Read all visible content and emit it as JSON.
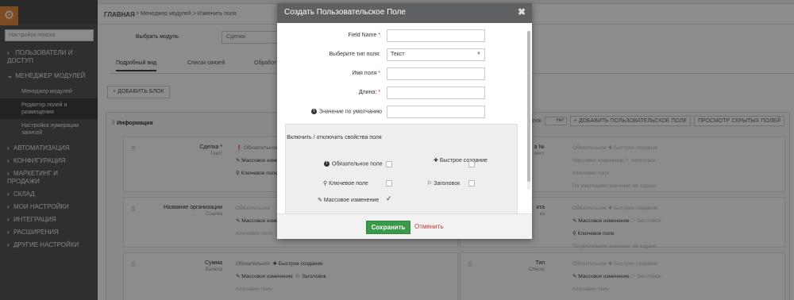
{
  "breadcrumb": {
    "home": "ГЛАВНАЯ",
    "rest": "> Менеджер модулей > Изменить поля"
  },
  "sidebar": {
    "search_placeholder": "Настройки поиска",
    "items": [
      {
        "label": "ПОЛЬЗОВАТЕЛИ И ДОСТУП",
        "chev": "›"
      },
      {
        "label": "МЕНЕДЖЕР МОДУЛЕЙ",
        "chev": "⌄"
      }
    ],
    "subitems": [
      {
        "label": "Менеджер модулей"
      },
      {
        "label": "Редактор полей и размещения"
      },
      {
        "label": "Настройка нумерации записей"
      }
    ],
    "items_after": [
      {
        "label": "АВТОМАТИЗАЦИЯ"
      },
      {
        "label": "КОНФИГУРАЦИЯ"
      },
      {
        "label": "МАРКЕТИНГ И ПРОДАЖИ"
      },
      {
        "label": "СКЛАД"
      },
      {
        "label": "МОИ НАСТРОЙКИ"
      },
      {
        "label": "ИНТЕГРАЦИЯ"
      },
      {
        "label": "РАСШИРЕНИЯ"
      },
      {
        "label": "ДРУГИЕ НАСТРОЙКИ"
      }
    ]
  },
  "main": {
    "select_label": "Выбрать модуль",
    "select_value": "Сделки",
    "tabs": [
      "Подробный вид",
      "Список связей",
      "Обработ"
    ],
    "add_block": "ДОБАВИТЬ БЛОК",
    "block": {
      "title": "Информация",
      "collapse_label": "Свернуть блок",
      "toggle": "Нет",
      "add_field": "ДОБАВИТЬ ПОЛЬЗОВАТЕЛЬСКОЕ ПОЛЕ",
      "show_hidden": "ПРОСМОТР СКРЫТЫХ ПОЛЕЙ"
    },
    "fields": [
      {
        "name": "Сделка *",
        "type": "Текст"
      },
      {
        "name": "Название организации",
        "type": "Ссылка"
      },
      {
        "name": "Сумма",
        "type": "Валюта"
      }
    ],
    "right_fields": [
      {
        "name": "а №",
        "type": "мест"
      },
      {
        "name": "кта",
        "type": "ка"
      },
      {
        "name": "Тип",
        "type": "Список"
      }
    ],
    "props": {
      "mandatory": "Обязательное",
      "quick_create": "Быстрое создание",
      "mass_edit": "Массовое изменение",
      "header": "Заголовок",
      "key_field": "Ключевое поле",
      "default_hint": "По умолчанию значение не задано"
    }
  },
  "modal": {
    "title": "Создать Пользовательское Поле",
    "close": "✖",
    "rows": [
      {
        "label": "Field Name",
        "required": "*",
        "value": ""
      },
      {
        "label": "Выберите тип поля:",
        "required": "",
        "value": "Текст"
      },
      {
        "label": "Имя поля",
        "required": "*",
        "value": ""
      },
      {
        "label": "Длина:",
        "required": "*",
        "value": ""
      },
      {
        "label": "Значение по умолчанию",
        "required": "",
        "value": ""
      }
    ],
    "props_heading": "Включить / отключить свойства поля",
    "props": {
      "mandatory": "Обязательное поле",
      "quick_create": "Быстрое создание",
      "key_field": "Ключевое поле",
      "header": "Заголовок",
      "mass_edit": "Массовое изменение"
    },
    "save": "Сохранить",
    "cancel": "Отменить"
  },
  "colors": {
    "accent": "#e58a3c",
    "save": "#3a9a4a",
    "cancel": "#c0392b",
    "sidebar": "#565656",
    "modal_head": "#5e6163"
  }
}
